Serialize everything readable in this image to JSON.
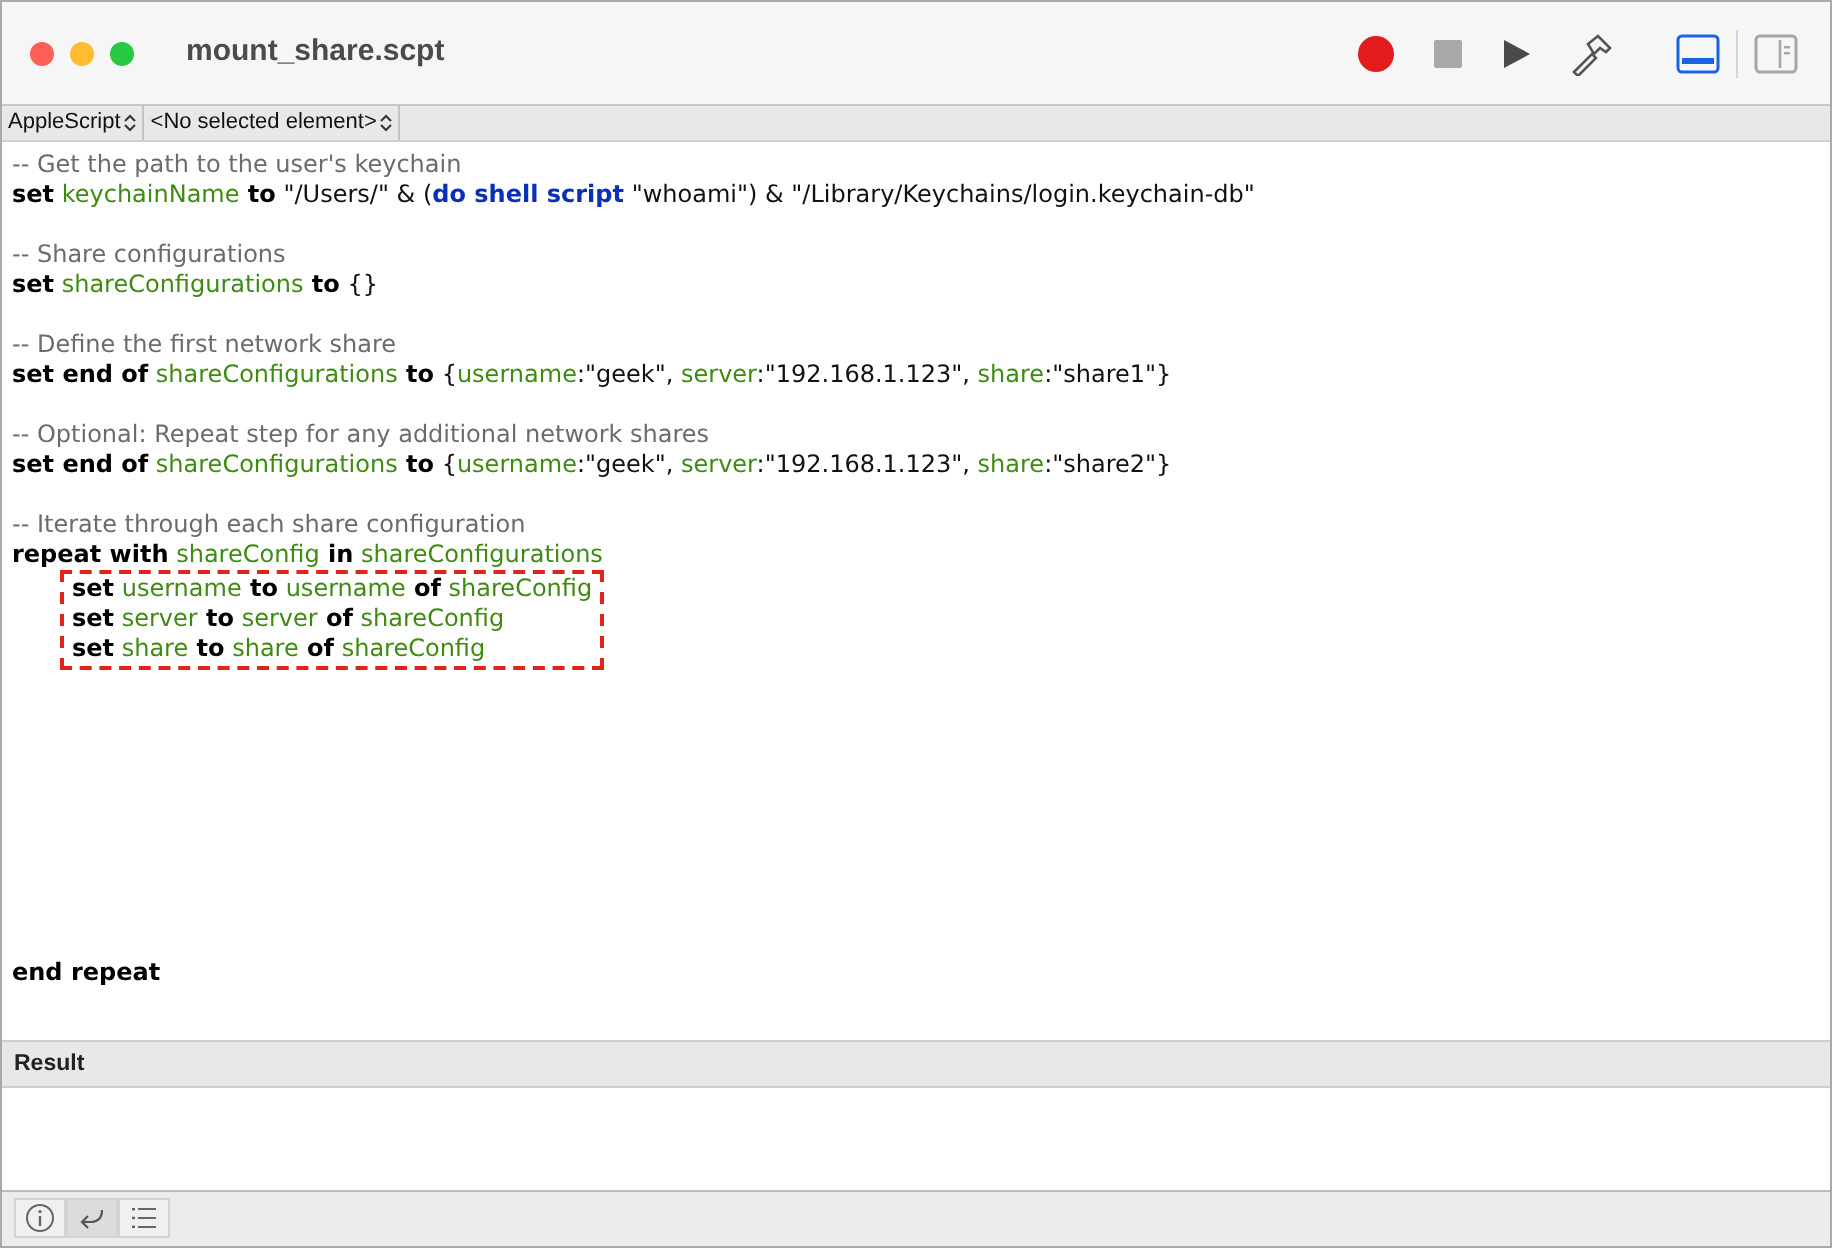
{
  "window": {
    "title": "mount_share.scpt"
  },
  "toolbar": {
    "buttons": [
      {
        "kind": "record"
      },
      {
        "kind": "stop"
      },
      {
        "kind": "run"
      },
      {
        "kind": "compile"
      }
    ],
    "view_toggles": [
      {
        "kind": "bottom",
        "selected": true
      },
      {
        "kind": "side",
        "selected": false
      }
    ]
  },
  "navigation_bar": {
    "popups": [
      {
        "label": "AppleScript"
      },
      {
        "label": "<No selected element>"
      }
    ]
  },
  "editor": {
    "blocks": [
      {
        "lines": [
          [
            {
              "kind": "comment",
              "text": "-- Get the path to the user's keychain"
            }
          ],
          [
            {
              "kind": "keyword",
              "text": "set"
            },
            {
              "kind": "variable",
              "text": " keychainName"
            },
            {
              "kind": "keyword",
              "text": " to"
            },
            {
              "kind": "plain",
              "text": " \"/Users/\" & ("
            },
            {
              "kind": "command",
              "text": "do shell script"
            },
            {
              "kind": "plain",
              "text": " \"whoami\") & \"/Library/Keychains/login.keychain-db\""
            }
          ]
        ]
      },
      {
        "lines": [
          [
            {
              "kind": "comment",
              "text": "-- Share configurations"
            }
          ],
          [
            {
              "kind": "keyword",
              "text": "set"
            },
            {
              "kind": "variable",
              "text": " shareConfigurations"
            },
            {
              "kind": "keyword",
              "text": " to"
            },
            {
              "kind": "plain",
              "text": " {}"
            }
          ]
        ]
      },
      {
        "lines": [
          [
            {
              "kind": "comment",
              "text": "-- Define the first network share"
            }
          ],
          [
            {
              "kind": "keyword",
              "text": "set end of"
            },
            {
              "kind": "variable",
              "text": " shareConfigurations"
            },
            {
              "kind": "keyword",
              "text": " to"
            },
            {
              "kind": "plain",
              "text": " {"
            },
            {
              "kind": "variable",
              "text": "username"
            },
            {
              "kind": "plain",
              "text": ":\"geek\", "
            },
            {
              "kind": "variable",
              "text": "server"
            },
            {
              "kind": "plain",
              "text": ":\"192.168.1.123\", "
            },
            {
              "kind": "variable",
              "text": "share"
            },
            {
              "kind": "plain",
              "text": ":\"share1\"}"
            }
          ]
        ]
      },
      {
        "lines": [
          [
            {
              "kind": "comment",
              "text": "-- Optional: Repeat step for any additional network shares"
            }
          ],
          [
            {
              "kind": "keyword",
              "text": "set end of"
            },
            {
              "kind": "variable",
              "text": " shareConfigurations"
            },
            {
              "kind": "keyword",
              "text": " to"
            },
            {
              "kind": "plain",
              "text": " {"
            },
            {
              "kind": "variable",
              "text": "username"
            },
            {
              "kind": "plain",
              "text": ":\"geek\", "
            },
            {
              "kind": "variable",
              "text": "server"
            },
            {
              "kind": "plain",
              "text": ":\"192.168.1.123\", "
            },
            {
              "kind": "variable",
              "text": "share"
            },
            {
              "kind": "plain",
              "text": ":\"share2\"}"
            }
          ]
        ]
      },
      {
        "lines": [
          [
            {
              "kind": "comment",
              "text": "-- Iterate through each share configuration"
            }
          ],
          [
            {
              "kind": "keyword",
              "text": "repeat with"
            },
            {
              "kind": "variable",
              "text": " shareConfig"
            },
            {
              "kind": "keyword",
              "text": " in"
            },
            {
              "kind": "variable",
              "text": " shareConfigurations"
            }
          ]
        ],
        "boxed_lines": [
          [
            {
              "kind": "keyword",
              "text": "set"
            },
            {
              "kind": "variable",
              "text": " username"
            },
            {
              "kind": "keyword",
              "text": " to"
            },
            {
              "kind": "variable",
              "text": " username"
            },
            {
              "kind": "keyword",
              "text": " of"
            },
            {
              "kind": "variable",
              "text": " shareConfig"
            }
          ],
          [
            {
              "kind": "keyword",
              "text": "set"
            },
            {
              "kind": "variable",
              "text": " server"
            },
            {
              "kind": "keyword",
              "text": " to"
            },
            {
              "kind": "variable",
              "text": " server"
            },
            {
              "kind": "keyword",
              "text": " of"
            },
            {
              "kind": "variable",
              "text": " shareConfig"
            }
          ],
          [
            {
              "kind": "keyword",
              "text": "set"
            },
            {
              "kind": "variable",
              "text": " share"
            },
            {
              "kind": "keyword",
              "text": " to"
            },
            {
              "kind": "variable",
              "text": " share"
            },
            {
              "kind": "keyword",
              "text": " of"
            },
            {
              "kind": "variable",
              "text": " shareConfig"
            }
          ]
        ]
      }
    ],
    "end_line": [
      {
        "kind": "keyword",
        "text": "end repeat"
      }
    ]
  },
  "result_pane": {
    "title": "Result"
  },
  "bottom_bar": {
    "buttons": [
      {
        "kind": "info",
        "selected": false
      },
      {
        "kind": "reply",
        "selected": true
      },
      {
        "kind": "log",
        "selected": false
      }
    ]
  }
}
